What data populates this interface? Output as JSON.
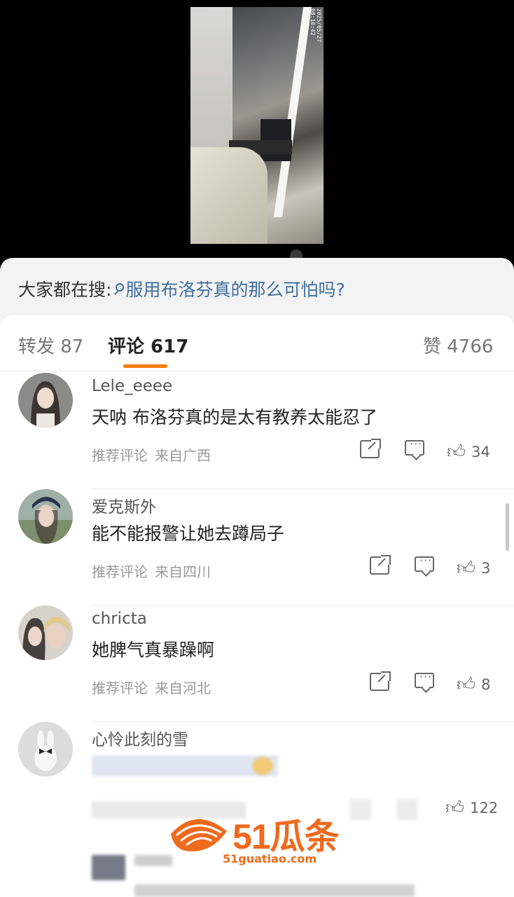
{
  "video": {
    "timestamp": "2025/05/27 08:10:42"
  },
  "search": {
    "prefix": "大家都在搜:",
    "query": "服用布洛芬真的那么可怕吗?"
  },
  "tabs": {
    "repost": "转发 87",
    "comments": "评论 617",
    "likes": "赞 4766"
  },
  "comments": [
    {
      "user": "Lele_eeee",
      "text": "天呐 布洛芬真的是太有教养太能忍了",
      "tag": "推荐评论",
      "location": "来自广西",
      "likes": "34"
    },
    {
      "user": "爱克斯外",
      "text": "能不能报警让她去蹲局子",
      "tag": "推荐评论",
      "location": "来自四川",
      "likes": "3"
    },
    {
      "user": "chricta",
      "text": "她脾气真暴躁啊",
      "tag": "推荐评论",
      "location": "来自河北",
      "likes": "8"
    },
    {
      "user": "心怜此刻的雪",
      "likes": "122"
    }
  ],
  "watermark": {
    "brand": "51瓜条",
    "url": "51guatiao.com"
  },
  "colors": {
    "accent": "#f57c00",
    "link": "#3f6e9e",
    "watermark": "#f06a1d"
  }
}
